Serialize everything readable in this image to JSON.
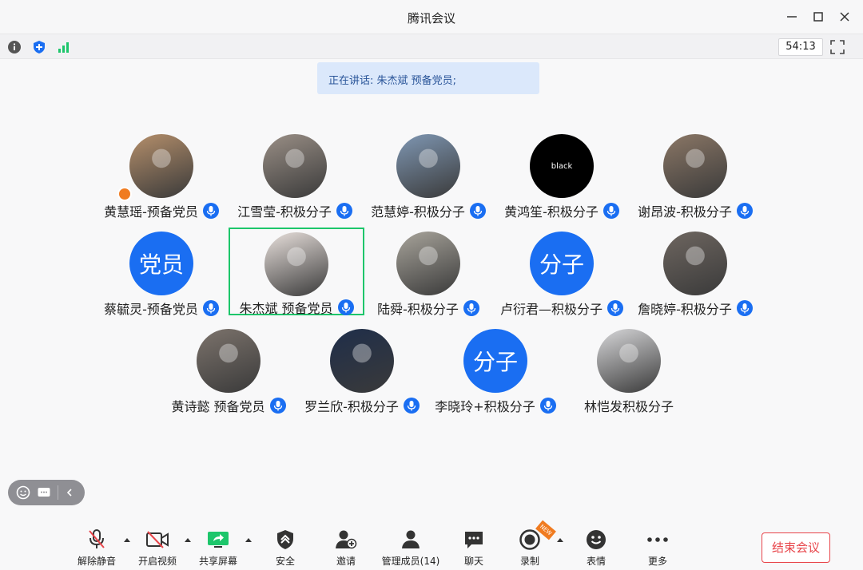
{
  "window": {
    "title": "腾讯会议"
  },
  "status": {
    "timer": "54:13"
  },
  "speaking": {
    "text": "正在讲话: 朱杰斌 预备党员;"
  },
  "participants": [
    {
      "name": "黄慧瑶-预备党员",
      "avatar": "photo",
      "mic": true,
      "badge": true
    },
    {
      "name": "江雪莹-积极分子",
      "avatar": "photo",
      "mic": true
    },
    {
      "name": "范慧婷-积极分子",
      "avatar": "photo",
      "mic": true
    },
    {
      "name": "黄鸿笙-积极分子",
      "avatar": "black",
      "avatar_text": "black",
      "mic": true
    },
    {
      "name": "谢昂波-积极分子",
      "avatar": "photo",
      "mic": true
    },
    {
      "name": "蔡毓灵-预备党员",
      "avatar": "text",
      "avatar_text": "党员",
      "mic": true
    },
    {
      "name": "朱杰斌 预备党员",
      "avatar": "photo",
      "mic": true,
      "active": true
    },
    {
      "name": "陆舜-积极分子",
      "avatar": "photo",
      "mic": true
    },
    {
      "name": "卢衍君—积极分子",
      "avatar": "text",
      "avatar_text": "分子",
      "mic": true
    },
    {
      "name": "詹晓婷-积极分子",
      "avatar": "photo",
      "mic": true
    },
    {
      "name": "黄诗懿 预备党员",
      "avatar": "photo",
      "mic": true
    },
    {
      "name": "罗兰欣-积极分子",
      "avatar": "photo",
      "mic": true
    },
    {
      "name": "李晓玲+积极分子",
      "avatar": "text",
      "avatar_text": "分子",
      "mic": true
    },
    {
      "name": "林恺发积极分子",
      "avatar": "photo",
      "mic": false
    }
  ],
  "toolbar": {
    "mute": "解除静音",
    "video": "开启视频",
    "share": "共享屏幕",
    "security": "安全",
    "invite": "邀请",
    "members": "管理成员(14)",
    "chat": "聊天",
    "record": "录制",
    "record_badge": "NEW",
    "reactions": "表情",
    "more": "更多",
    "end": "结束会议"
  },
  "colors": {
    "accent": "#1a6ef2",
    "active": "#1dc66b",
    "end": "#e8454a"
  }
}
